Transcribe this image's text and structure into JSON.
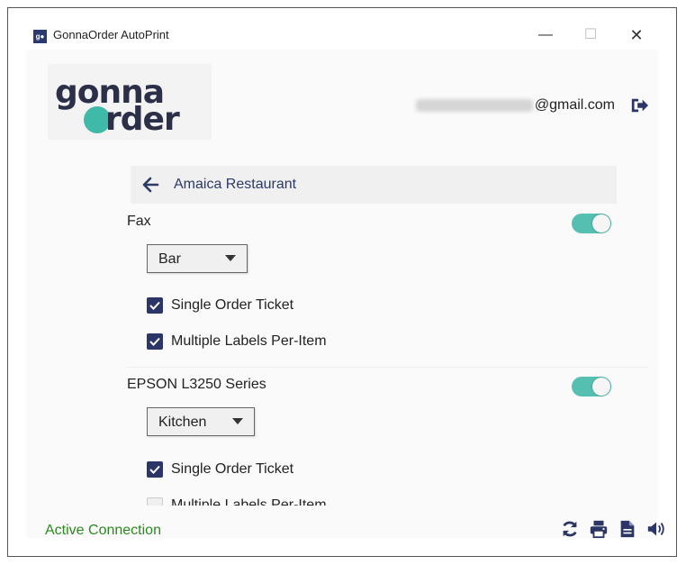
{
  "window": {
    "title": "GonnaOrder AutoPrint",
    "icon_text": "g●",
    "controls": {
      "minimize": "—",
      "maximize": "☐",
      "close": "✕"
    }
  },
  "logo": {
    "line1": "gonna",
    "line2": "rder",
    "circle_color": "#3fb9a8",
    "text_color": "#2b2f47"
  },
  "account": {
    "email_domain": "@gmail.com",
    "logout_icon": "sign-out-icon"
  },
  "header": {
    "back_icon": "arrow-left-icon",
    "restaurant": "Amaica Restaurant"
  },
  "printers": [
    {
      "name": "Fax",
      "enabled": true,
      "station": "Bar",
      "options": [
        {
          "label": "Single Order Ticket",
          "checked": true
        },
        {
          "label": "Multiple Labels Per-Item",
          "checked": true
        }
      ]
    },
    {
      "name": "EPSON L3250 Series",
      "enabled": true,
      "station": "Kitchen",
      "options": [
        {
          "label": "Single Order Ticket",
          "checked": true
        },
        {
          "label": "Multiple Labels Per-Item",
          "checked": false
        }
      ]
    }
  ],
  "status": {
    "text": "Active Connection",
    "color": "#2b8a1f"
  },
  "footer_icons": [
    "sync-icon",
    "printer-icon",
    "document-icon",
    "volume-icon"
  ],
  "colors": {
    "accent": "#2b3566",
    "toggle_on": "#55bfb1"
  }
}
